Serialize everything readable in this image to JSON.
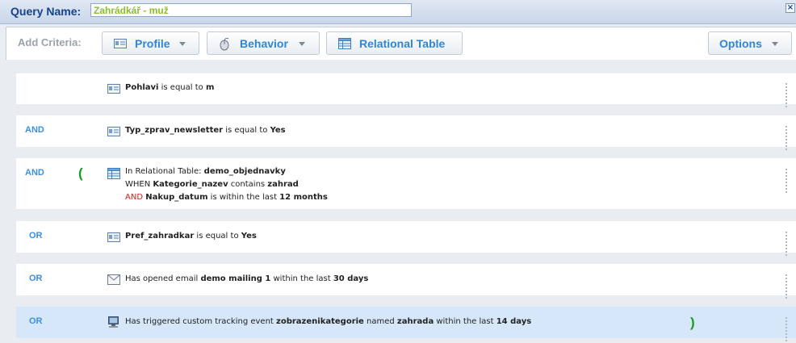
{
  "header": {
    "query_label": "Query Name:",
    "query_value": "Zahrádkář - muž",
    "close_icon": "close-icon"
  },
  "toolbar": {
    "add_criteria_label": "Add Criteria:",
    "profile_label": "Profile",
    "behavior_label": "Behavior",
    "relational_label": "Relational Table",
    "options_label": "Options"
  },
  "rows": [
    {
      "operator": "",
      "icon": "profile-icon",
      "parts": {
        "field": "Pohlavi",
        "cmp": " is equal to ",
        "value": "m"
      }
    },
    {
      "operator": "AND",
      "icon": "profile-icon",
      "parts": {
        "field": "Typ_zprav_newsletter",
        "cmp": " is equal to ",
        "value": "Yes"
      }
    },
    {
      "operator": "AND",
      "open_paren": "(",
      "icon": "table-icon",
      "parts": {
        "l1_pre": "In Relational Table: ",
        "table": "demo_objednavky",
        "l2_pre": "WHEN ",
        "field1": "Kategorie_nazev",
        "cmp1": " contains ",
        "value1": "zahrad",
        "and": "AND",
        "field2": "Nakup_datum",
        "cmp2": " is within the last ",
        "value2": "12 months"
      }
    },
    {
      "operator": "OR",
      "icon": "profile-icon",
      "parts": {
        "field": "Pref_zahradkar",
        "cmp": " is equal to ",
        "value": "Yes"
      }
    },
    {
      "operator": "OR",
      "icon": "email-icon",
      "parts": {
        "pre": "Has opened email ",
        "name": "demo mailing 1",
        "mid": " within the last ",
        "period": "30 days"
      }
    },
    {
      "operator": "OR",
      "icon": "monitor-icon",
      "close_paren": ")",
      "parts": {
        "pre": "Has triggered custom tracking event ",
        "event": "zobrazenikategorie",
        "mid": " named ",
        "name": "zahrada",
        "mid2": " within the last ",
        "period": "14 days"
      }
    }
  ],
  "colors": {
    "operator": "#3b8fde",
    "paren": "#1a9a2a",
    "and_inline": "#d42020",
    "selected_row": "#d5e7f9",
    "query_value": "#8bbf2a",
    "header_label": "#15428b"
  }
}
